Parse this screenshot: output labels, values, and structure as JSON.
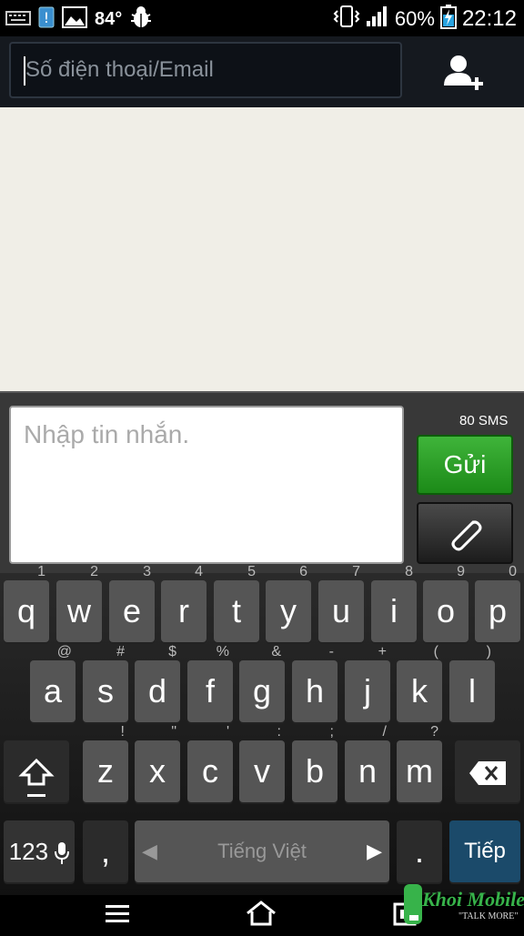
{
  "status": {
    "temperature": "84°",
    "battery": "60%",
    "time": "22:12"
  },
  "header": {
    "to_placeholder": "Số điện thoại/Email"
  },
  "compose": {
    "message_placeholder": "Nhập tin nhắn.",
    "sms_counter": "80  SMS",
    "send_label": "Gửi"
  },
  "keyboard": {
    "row1": [
      {
        "ch": "q",
        "hint": "1"
      },
      {
        "ch": "w",
        "hint": "2"
      },
      {
        "ch": "e",
        "hint": "3"
      },
      {
        "ch": "r",
        "hint": "4"
      },
      {
        "ch": "t",
        "hint": "5"
      },
      {
        "ch": "y",
        "hint": "6"
      },
      {
        "ch": "u",
        "hint": "7"
      },
      {
        "ch": "i",
        "hint": "8"
      },
      {
        "ch": "o",
        "hint": "9"
      },
      {
        "ch": "p",
        "hint": "0"
      }
    ],
    "row2": [
      {
        "ch": "a",
        "hint": "@"
      },
      {
        "ch": "s",
        "hint": "#"
      },
      {
        "ch": "d",
        "hint": "$"
      },
      {
        "ch": "f",
        "hint": "%"
      },
      {
        "ch": "g",
        "hint": "&"
      },
      {
        "ch": "h",
        "hint": "-"
      },
      {
        "ch": "j",
        "hint": "+"
      },
      {
        "ch": "k",
        "hint": "("
      },
      {
        "ch": "l",
        "hint": ")"
      }
    ],
    "row3": [
      {
        "ch": "z",
        "hint": "!"
      },
      {
        "ch": "x",
        "hint": "\""
      },
      {
        "ch": "c",
        "hint": "'"
      },
      {
        "ch": "v",
        "hint": ":"
      },
      {
        "ch": "b",
        "hint": ";"
      },
      {
        "ch": "n",
        "hint": "/"
      },
      {
        "ch": "m",
        "hint": "?"
      }
    ],
    "numbers_label": "123",
    "comma": ",",
    "space_label": "Tiếng Việt",
    "period": ".",
    "enter_label": "Tiếp"
  },
  "watermark": {
    "text": "Khoi Mobile",
    "tagline": "\"TALK MORE\""
  },
  "colors": {
    "send_green": "#2aa526",
    "enter_blue": "#1b4a6a",
    "thread_bg": "#f0eee7"
  }
}
